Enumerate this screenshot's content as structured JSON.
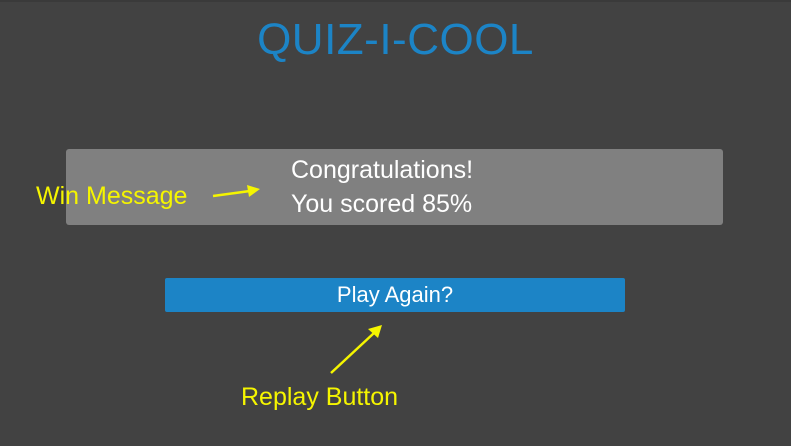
{
  "app": {
    "title": "QUIZ-I-COOL"
  },
  "result": {
    "line1": "Congratulations!",
    "line2": "You scored 85%",
    "score_percent": 85
  },
  "replay_button": {
    "label": "Play Again?"
  },
  "annotations": {
    "win_message": "Win Message",
    "replay_button": "Replay Button"
  },
  "colors": {
    "background": "#424242",
    "accent_blue": "#1c84c6",
    "panel_gray": "#808080",
    "annotation_yellow": "#f5f500",
    "text_white": "#ffffff"
  }
}
